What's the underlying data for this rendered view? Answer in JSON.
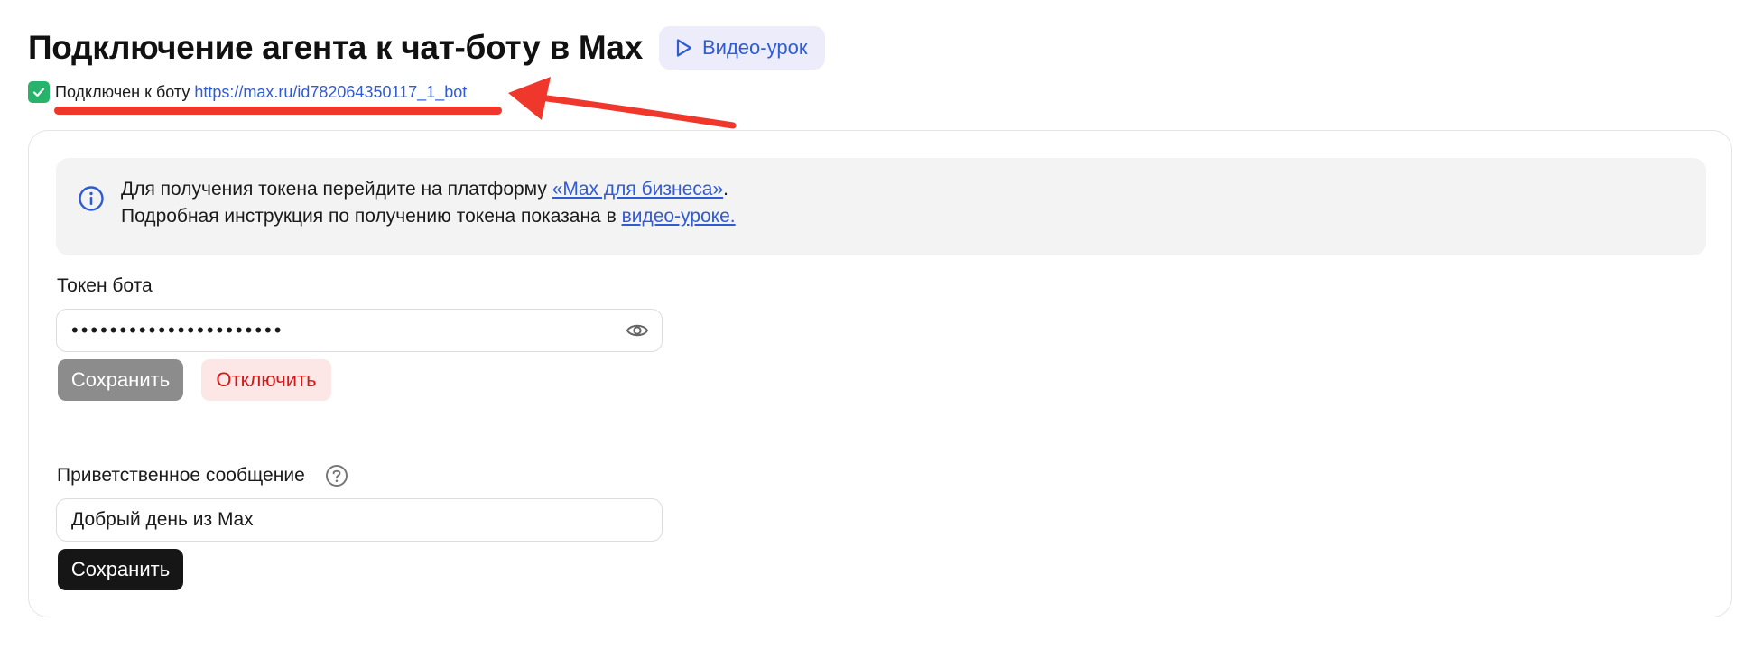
{
  "header": {
    "title": "Подключение агента к чат-боту в Max",
    "video_button": "Видео-урок"
  },
  "status": {
    "label": "Подключен к боту",
    "link": "https://max.ru/id782064350117_1_bot"
  },
  "info": {
    "line1_text": "Для получения токена перейдите на платформу ",
    "line1_link": "«Max для бизнеса»",
    "line1_end": ".",
    "line2_text": "Подробная инструкция по получению токена показана в ",
    "line2_link": "видео-уроке."
  },
  "token": {
    "label": "Токен бота",
    "value": "••••••••••••••••••••••",
    "save_button": "Сохранить",
    "disconnect_button": "Отключить"
  },
  "greeting": {
    "label": "Приветственное сообщение",
    "value": "Добрый день из Max",
    "save_button": "Сохранить"
  },
  "icons": {
    "video": "play-icon",
    "status": "checkbox-checked-icon",
    "info": "info-icon",
    "token_visibility": "eye-icon",
    "greeting_help": "question-icon"
  },
  "colors": {
    "accent": "#2f5bd3",
    "success": "#27b36a",
    "danger": "#d11a1a",
    "annotation": "#f0372c"
  }
}
